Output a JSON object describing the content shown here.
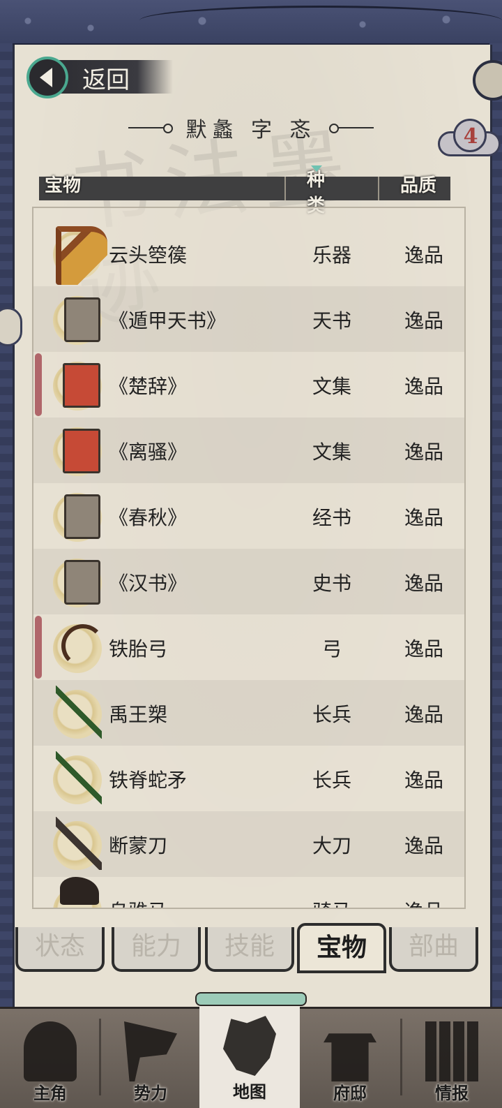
{
  "back": {
    "label": "返回"
  },
  "title": "默蠡 字 忞",
  "badge": {
    "count": "4"
  },
  "header": {
    "name": "宝物",
    "type": "种类",
    "quality": "品质"
  },
  "items": [
    {
      "name": "云头箜篌",
      "type": "乐器",
      "quality": "逸品",
      "icon": "harp-icon"
    },
    {
      "name": "《遁甲天书》",
      "type": "天书",
      "quality": "逸品",
      "icon": "book-icon"
    },
    {
      "name": "《楚辞》",
      "type": "文集",
      "quality": "逸品",
      "icon": "red-book-icon"
    },
    {
      "name": "《离骚》",
      "type": "文集",
      "quality": "逸品",
      "icon": "red-book-icon"
    },
    {
      "name": "《春秋》",
      "type": "经书",
      "quality": "逸品",
      "icon": "book-icon"
    },
    {
      "name": "《汉书》",
      "type": "史书",
      "quality": "逸品",
      "icon": "book-icon"
    },
    {
      "name": "铁胎弓",
      "type": "弓",
      "quality": "逸品",
      "icon": "bow-icon"
    },
    {
      "name": "禹王槊",
      "type": "长兵",
      "quality": "逸品",
      "icon": "spear-icon"
    },
    {
      "name": "铁脊蛇矛",
      "type": "长兵",
      "quality": "逸品",
      "icon": "spear-icon"
    },
    {
      "name": "断蒙刀",
      "type": "大刀",
      "quality": "逸品",
      "icon": "blade-icon"
    },
    {
      "name": "乌骓马",
      "type": "骑马",
      "quality": "逸品",
      "icon": "horse-icon"
    }
  ],
  "tabs": [
    {
      "label": "状态"
    },
    {
      "label": "能力"
    },
    {
      "label": "技能"
    },
    {
      "label": "宝物"
    },
    {
      "label": "部曲"
    }
  ],
  "nav": [
    {
      "label": "主角"
    },
    {
      "label": "势力"
    },
    {
      "label": "地图"
    },
    {
      "label": "府邸"
    },
    {
      "label": "情报"
    }
  ],
  "colors": {
    "accent": "#4aa88f",
    "panel": "#e7e1d3",
    "frame": "#3b4260",
    "mark": "#b0666a"
  }
}
